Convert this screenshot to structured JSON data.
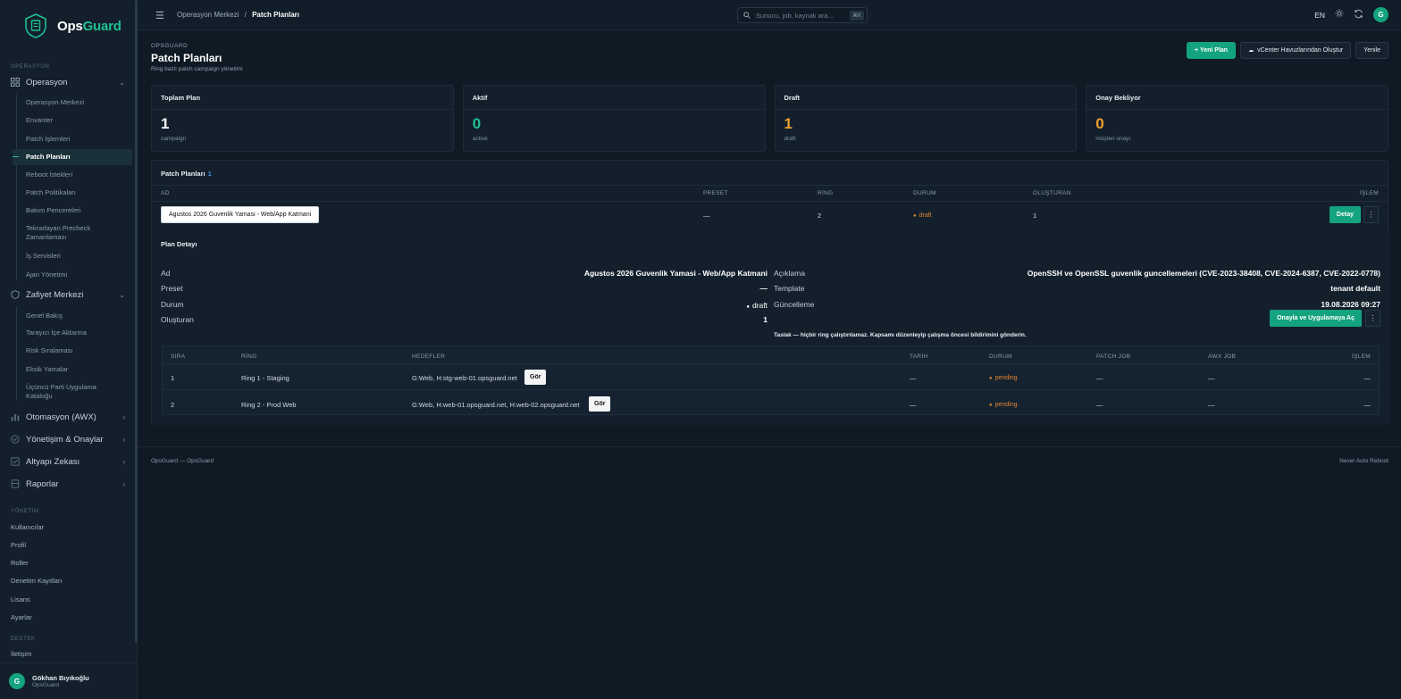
{
  "brand": {
    "part1": "Ops",
    "part2": "Guard"
  },
  "sidebar": {
    "section_ops": "OPERASYON",
    "group_ops": "Operasyon",
    "ops_items": [
      "Operasyon Merkezi",
      "Envanter",
      "Patch İşlemleri",
      "Patch Planları",
      "Reboot İstekleri",
      "Patch Politikaları",
      "Bakım Pencereleri",
      "Tekrarlayan Precheck Zamanlaması",
      "İş Servisleri",
      "Ajan Yönetimi"
    ],
    "group_vuln": "Zafiyet Merkezi",
    "vuln_items": [
      "Genel Bakış",
      "Tarayıcı İçe Aktarma",
      "Risk Sıralaması",
      "Eksik Yamalar",
      "Üçüncü Parti Uygulama Kataloğu"
    ],
    "group_auto": "Otomasyon (AWX)",
    "group_gov": "Yönetişim & Onaylar",
    "group_infra": "Altyapı Zekası",
    "group_reports": "Raporlar",
    "section_admin": "YÖNETİM",
    "admin_items": [
      "Kullanıcılar",
      "Profil",
      "Roller",
      "Denetim Kayıtları",
      "Lisans",
      "Ayarlar"
    ],
    "section_support": "DESTEK",
    "support_items": [
      "İletişim"
    ],
    "user": {
      "initial": "G",
      "name": "Gökhan Bıyıkoğlu",
      "org": "OpsGuard"
    }
  },
  "topbar": {
    "crumb_parent": "Operasyon Merkezi",
    "crumb_sep": "/",
    "crumb_current": "Patch Planları",
    "search_placeholder": "Sunucu, job, kaynak ara...",
    "search_kbd": "⌘K",
    "lang": "EN",
    "avatar": "G"
  },
  "page": {
    "eyebrow": "OPSGUARD",
    "title": "Patch Planları",
    "subtitle": "Ring bazlı patch campaign yönetimi",
    "actions": {
      "new": "+ Yeni Plan",
      "vcenter": "vCenter Havuzlarından Oluştur",
      "refresh": "Yenile"
    }
  },
  "cards": [
    {
      "title": "Toplam Plan",
      "value": "1",
      "sub": "campaign",
      "color": "#ffffff"
    },
    {
      "title": "Aktif",
      "value": "0",
      "sub": "active",
      "color": "#1fbf94"
    },
    {
      "title": "Draft",
      "value": "1",
      "sub": "draft",
      "color": "#f0a030"
    },
    {
      "title": "Onay Bekliyor",
      "value": "0",
      "sub": "müşteri onayı",
      "color": "#f0a030"
    }
  ],
  "plans": {
    "title": "Patch Planları",
    "count": "1",
    "columns": {
      "name": "AD",
      "preset": "PRESET",
      "ring": "RİNG",
      "status": "DURUM",
      "creator": "OLUŞTURAN",
      "action": "İŞLEM"
    },
    "row": {
      "name": "Agustos 2026 Guvenlik Yamasi - Web/App Katmani",
      "preset": "—",
      "ring": "2",
      "status": "draft",
      "creator": "1",
      "detail": "Detay",
      "more": "⋮"
    }
  },
  "detail": {
    "title": "Plan Detayı",
    "left": [
      {
        "k": "Ad",
        "v": "Agustos 2026 Guvenlik Yamasi - Web/App Katmani"
      },
      {
        "k": "Preset",
        "v": "—"
      },
      {
        "k": "Durum",
        "v": "draft"
      },
      {
        "k": "Oluşturan",
        "v": "1"
      }
    ],
    "right": [
      {
        "k": "Açıklama",
        "v": "OpenSSH ve OpenSSL guvenlik guncellemeleri (CVE-2023-38408, CVE-2024-6387, CVE-2022-0778)"
      },
      {
        "k": "Template",
        "v": "tenant default"
      },
      {
        "k": "Güncelleme",
        "v": "19.08.2026 09:27"
      }
    ],
    "approve": "Onayla ve Uygulamaya Aç",
    "note": "Taslak — hiçbir ring çalıştırılamaz. Kapsamı düzenleyip çalışma öncesi bildirimini gönderin.",
    "ring_columns": {
      "seq": "SIRA",
      "ring": "RİNG",
      "targets": "HEDEFLER",
      "date": "TARİH",
      "status": "DURUM",
      "patch_job": "PATCH JOB",
      "awx_job": "AWX JOB",
      "action": "İŞLEM"
    },
    "rings": [
      {
        "seq": "1",
        "ring": "Ring 1 - Staging",
        "targets": "G:Web, H:stg-web-01.opsguard.net",
        "see": "Gör",
        "date": "—",
        "status": "pending",
        "patch_job": "—",
        "awx_job": "—",
        "action": "—"
      },
      {
        "seq": "2",
        "ring": "Ring 2 - Prod Web",
        "targets": "G:Web, H:web-01.opsguard.net, H:web-02.opsguard.net",
        "see": "Gör",
        "date": "—",
        "status": "pending",
        "patch_job": "—",
        "awx_job": "—",
        "action": "—"
      }
    ]
  },
  "footer": {
    "left": "OpsGuard — OpsGuard",
    "right": "Never Auto Reboot"
  }
}
